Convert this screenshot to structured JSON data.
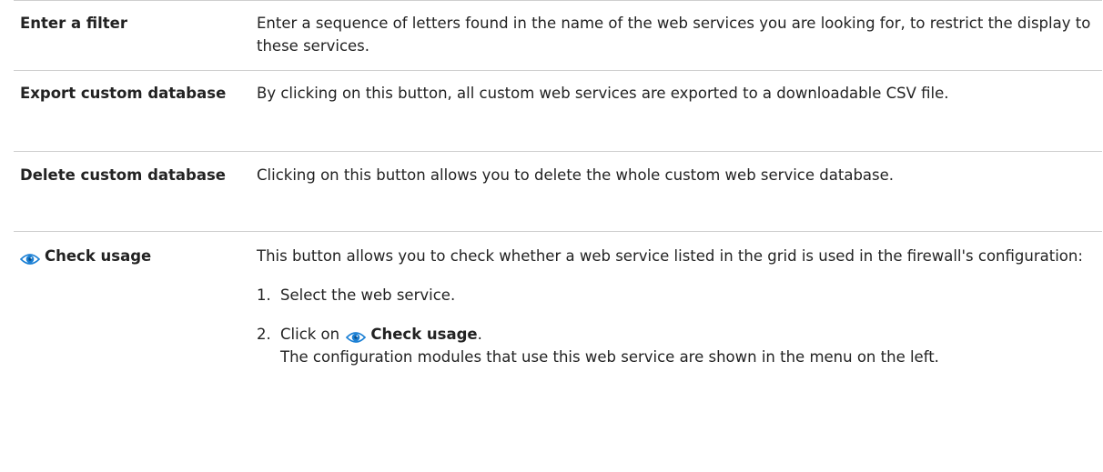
{
  "rows": [
    {
      "term": "Enter a filter",
      "description": "Enter a sequence of letters found in the name of the web services you are looking for, to restrict the display to these services."
    },
    {
      "term": "Export custom database",
      "description": "By clicking on this button, all custom web services are exported to a downloadable CSV file."
    },
    {
      "term": "Delete custom database",
      "description": "Clicking on this button allows you to delete the whole custom web service database."
    },
    {
      "term": "Check usage",
      "term_icon": "eye-icon",
      "description": "This button allows you to check whether a web service listed in the grid is used in the firewall's configuration:",
      "steps": [
        {
          "number": "1.",
          "text": "Select the web service."
        },
        {
          "number": "2.",
          "prefix": "Click on",
          "icon": "eye-icon",
          "button_label": "Check usage",
          "suffix": ".",
          "note": "The configuration modules that use this web service are shown in the menu on the left."
        }
      ]
    }
  ],
  "colors": {
    "icon_blue": "#1a7fd4",
    "border": "#cfcfcf",
    "text": "#222222"
  }
}
